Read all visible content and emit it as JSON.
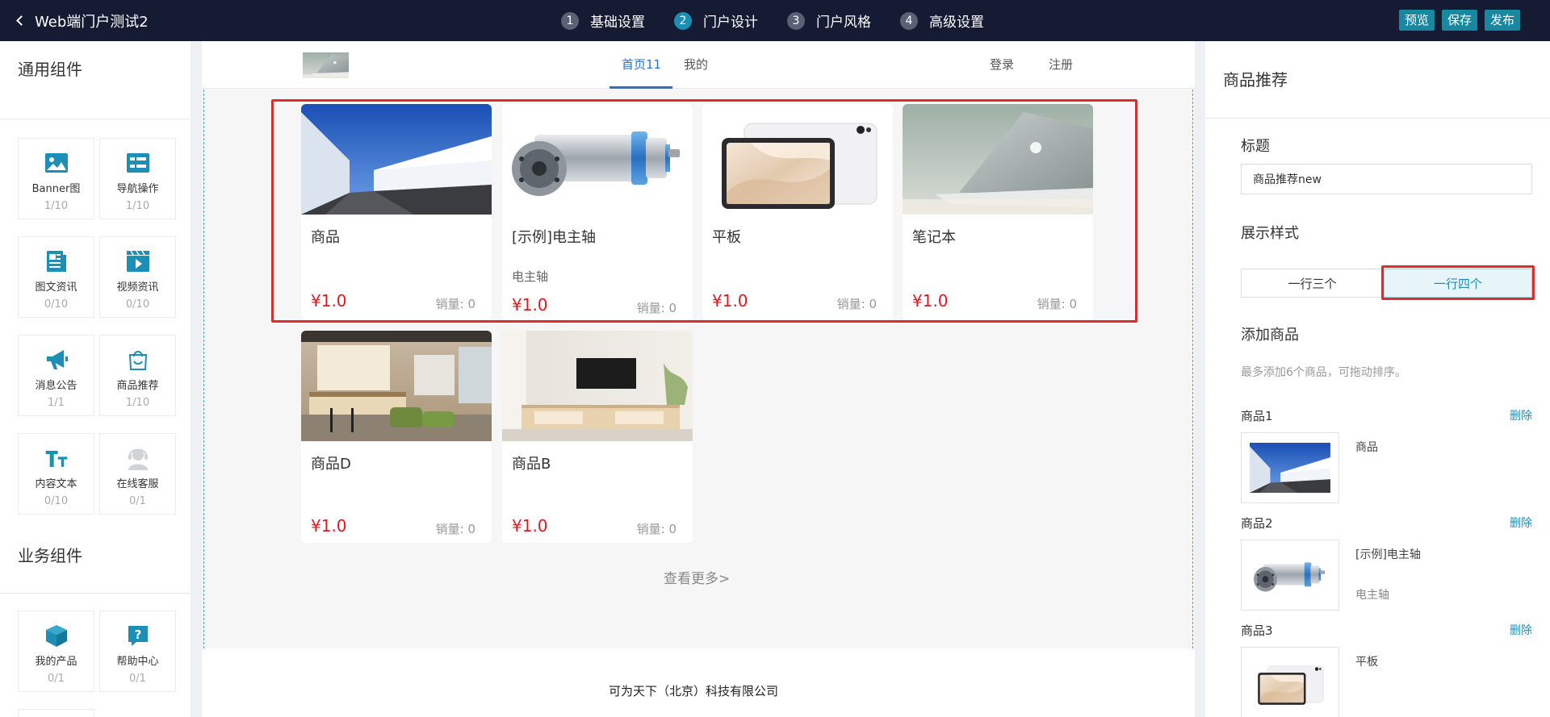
{
  "topbar": {
    "back_title": "Web端门户测试2",
    "steps": [
      {
        "num": "1",
        "label": "基础设置"
      },
      {
        "num": "2",
        "label": "门户设计"
      },
      {
        "num": "3",
        "label": "门户风格"
      },
      {
        "num": "4",
        "label": "高级设置"
      }
    ],
    "active_step": 2,
    "buttons": {
      "preview": "预览",
      "save": "保存",
      "publish": "发布"
    }
  },
  "left_panel": {
    "general_title": "通用组件",
    "general_items": [
      {
        "icon": "image-icon",
        "name": "Banner图",
        "count": "1/10"
      },
      {
        "icon": "grid-nav-icon",
        "name": "导航操作",
        "count": "1/10"
      },
      {
        "icon": "article-icon",
        "name": "图文资讯",
        "count": "0/10"
      },
      {
        "icon": "video-icon",
        "name": "视频资讯",
        "count": "0/10"
      },
      {
        "icon": "megaphone-icon",
        "name": "消息公告",
        "count": "1/1"
      },
      {
        "icon": "shopping-bag-icon",
        "name": "商品推荐",
        "count": "1/10"
      },
      {
        "icon": "text-icon",
        "name": "内容文本",
        "count": "0/10"
      },
      {
        "icon": "customer-service-icon",
        "name": "在线客服",
        "count": "0/1"
      }
    ],
    "business_title": "业务组件",
    "business_items": [
      {
        "icon": "box-icon",
        "name": "我的产品",
        "count": "0/1"
      },
      {
        "icon": "help-icon",
        "name": "帮助中心",
        "count": "0/1"
      }
    ]
  },
  "canvas": {
    "nav": {
      "tab_home": "首页11",
      "tab_mine": "我的",
      "login": "登录",
      "register": "注册"
    },
    "products": [
      {
        "title": "商品",
        "subtitle": "",
        "price": "¥1.0",
        "sales": "销量:  0",
        "image": "snow-road"
      },
      {
        "title": "[示例]电主轴",
        "subtitle": "电主轴",
        "price": "¥1.0",
        "sales": "销量:  0",
        "image": "spindle"
      },
      {
        "title": "平板",
        "subtitle": "",
        "price": "¥1.0",
        "sales": "销量:  0",
        "image": "tablet"
      },
      {
        "title": "笔记本",
        "subtitle": "",
        "price": "¥1.0",
        "sales": "销量:  0",
        "image": "laptop"
      },
      {
        "title": "商品D",
        "subtitle": "",
        "price": "¥1.0",
        "sales": "销量:  0",
        "image": "office"
      },
      {
        "title": "商品B",
        "subtitle": "",
        "price": "¥1.0",
        "sales": "销量:  0",
        "image": "tv-cabinet"
      }
    ],
    "view_more": "查看更多>",
    "footer": "可为天下（北京）科技有限公司"
  },
  "right_panel": {
    "title": "商品推荐",
    "title_label": "标题",
    "title_value": "商品推荐new",
    "style_label": "展示样式",
    "style_options": [
      "一行三个",
      "一行四个"
    ],
    "style_selected": "一行四个",
    "add_label": "添加商品",
    "add_hint": "最多添加6个商品，可拖动排序。",
    "delete_label": "删除",
    "items": [
      {
        "label": "商品1",
        "name": "商品",
        "sub": ""
      },
      {
        "label": "商品2",
        "name": "[示例]电主轴",
        "sub": "电主轴"
      },
      {
        "label": "商品3",
        "name": "平板",
        "sub": ""
      }
    ]
  },
  "colors": {
    "topbar": "#141b33",
    "accent": "#1b8fb5",
    "price": "#e0181f",
    "highlight": "#e02b2b",
    "nav_active": "#2d6fc9"
  }
}
